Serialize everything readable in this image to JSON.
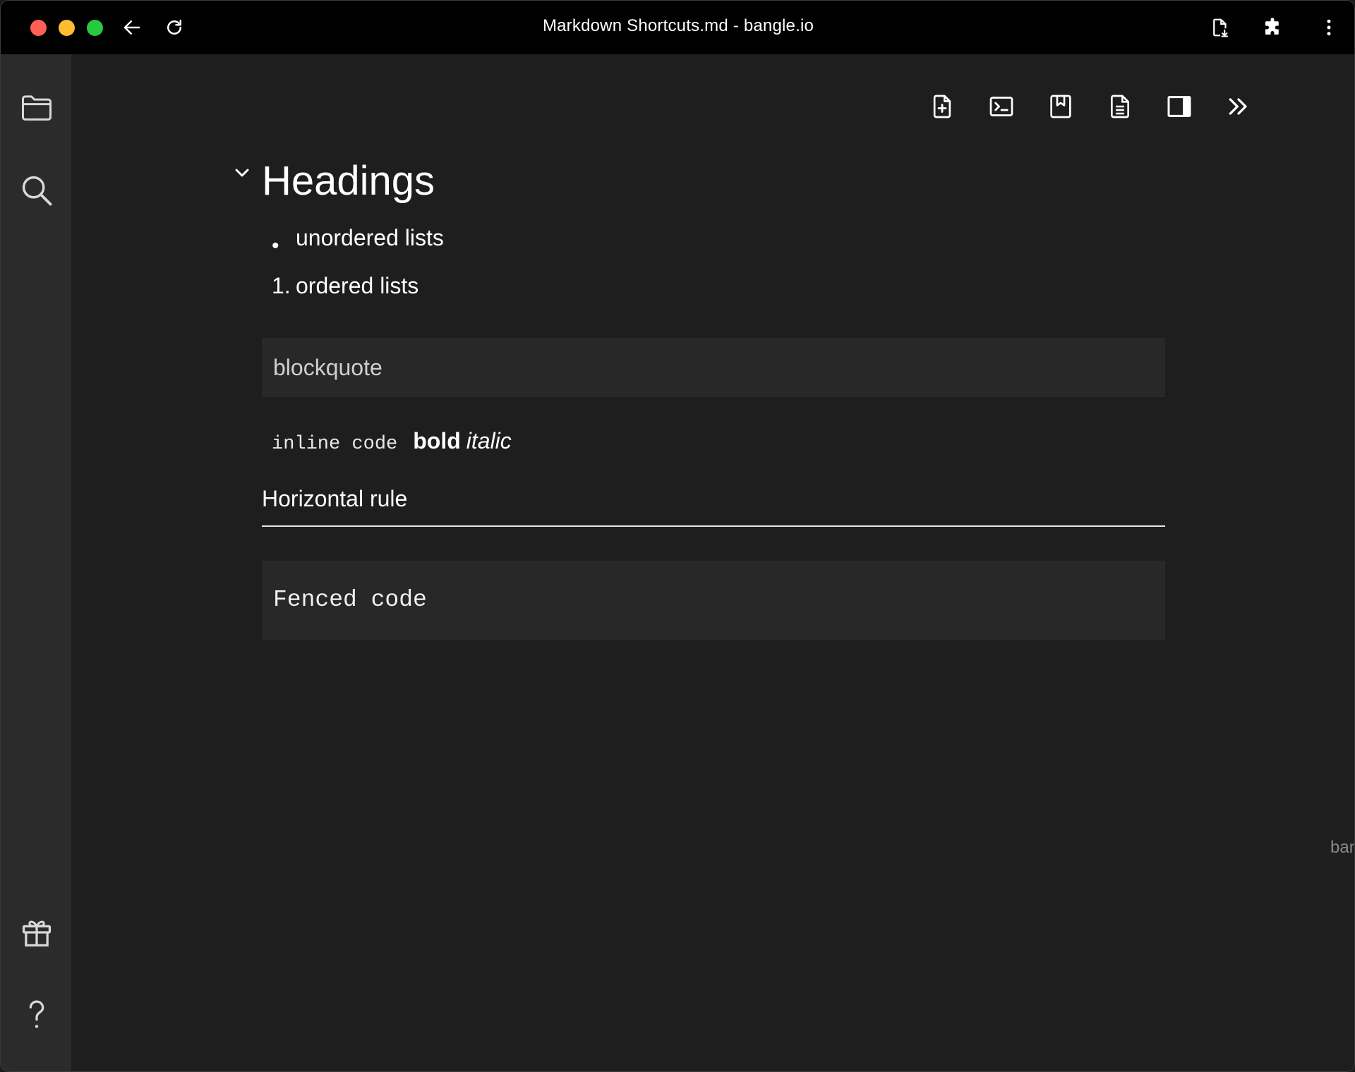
{
  "window": {
    "title": "Markdown Shortcuts.md - bangle.io"
  },
  "titlebar": {
    "icons": [
      "back-arrow-icon",
      "reload-icon",
      "download-file-icon",
      "extensions-puzzle-icon",
      "more-vertical-icon"
    ]
  },
  "sidebar": {
    "icons": [
      "folder-icon",
      "search-icon",
      "gift-icon",
      "help-question-icon"
    ]
  },
  "toolbar": {
    "icons": [
      "new-note-icon",
      "command-palette-icon",
      "bookmark-icon",
      "note-document-icon",
      "toggle-sidebar-icon",
      "double-chevron-right-icon"
    ]
  },
  "document": {
    "heading": "Headings",
    "unordered_item": "unordered lists",
    "ordered_marker": "1.",
    "ordered_item": "ordered lists",
    "blockquote": "blockquote",
    "inline_code": "inline code",
    "bold": "bold",
    "italic": "italic",
    "horizontal_rule_label": "Horizontal rule",
    "fenced_code": "Fenced code"
  },
  "footer": {
    "brand": "bangle.io"
  },
  "colors": {
    "background": "#1e1e1e",
    "sidebar": "#2b2b2b",
    "titlebar": "#000000",
    "code_block": "#282828"
  }
}
